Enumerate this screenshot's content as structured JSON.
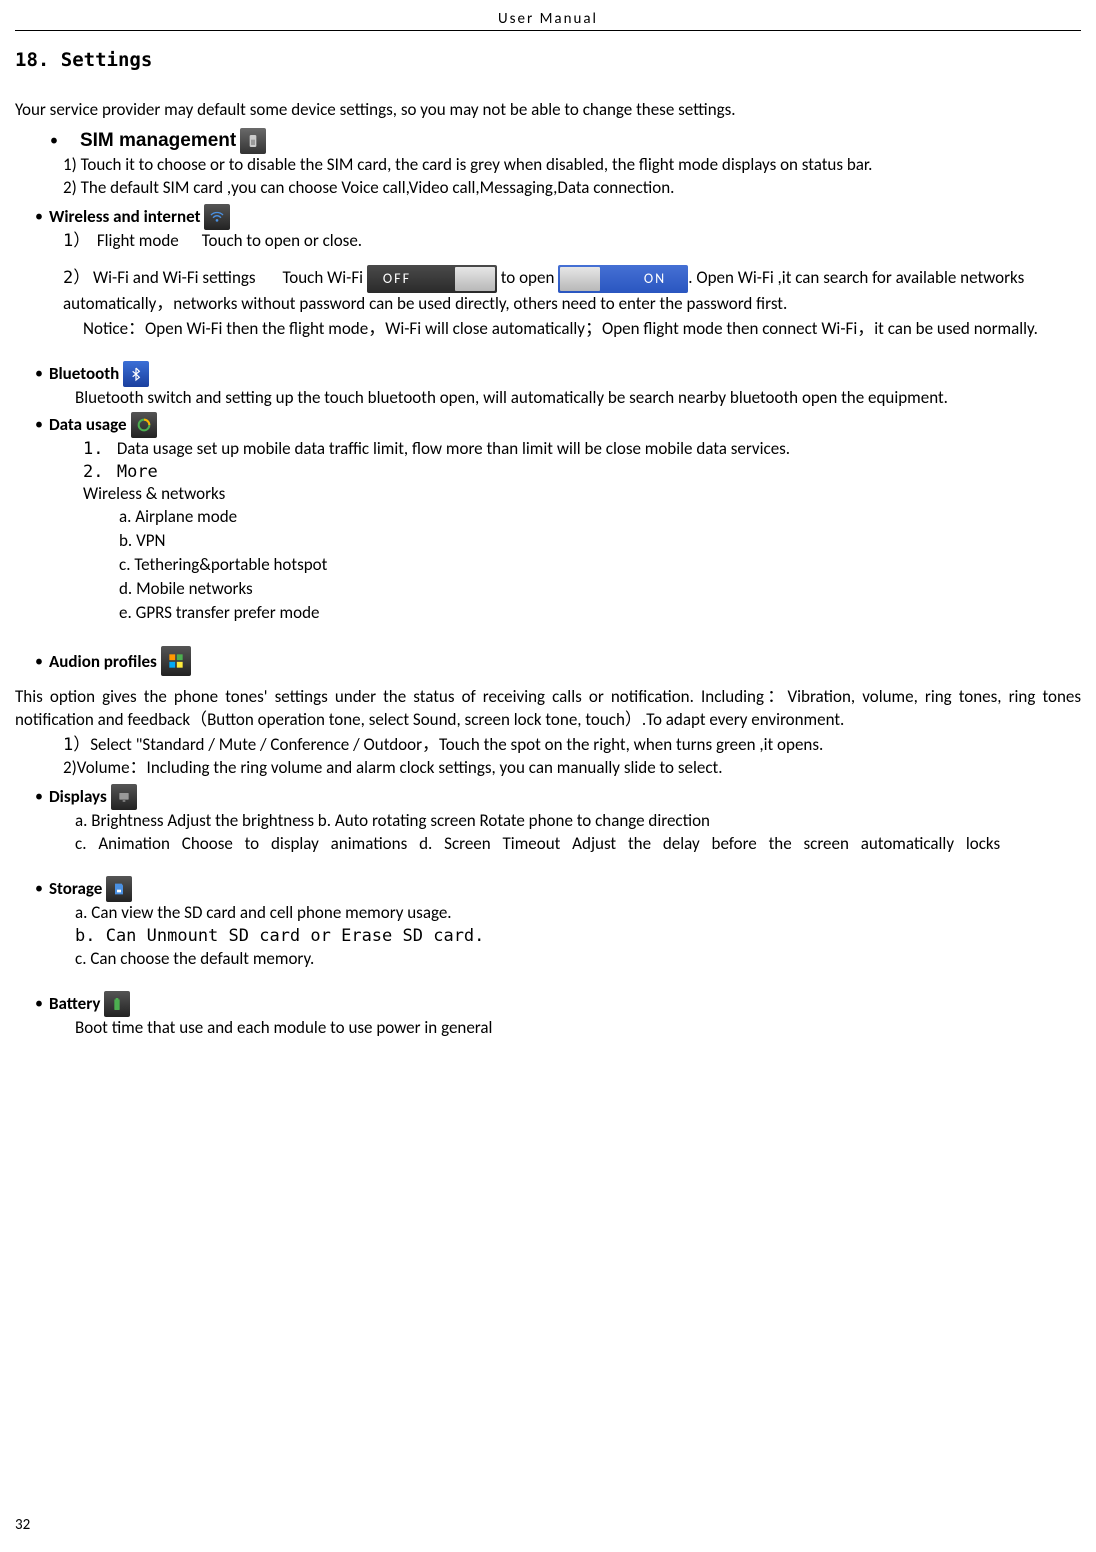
{
  "header": "User    Manual",
  "sectionTitle": "18. Settings",
  "intro": "Your service provider may default some device settings, so you may not be able to change these settings.",
  "sim": {
    "label": "SIM management",
    "p1": "1) Touch it to choose or to disable the SIM card, the card is grey when disabled, the flight mode displays on status bar.",
    "p2": "2) The default SIM card ,you can choose Voice call,Video call,Messaging,Data connection."
  },
  "wireless": {
    "label": "Wireless and internet",
    "n1": "1）",
    "flight_mode": "Flight mode",
    "flight_mode_desc": "Touch to open or close.",
    "n2": "2）",
    "wifi_a": "Wi-Fi and Wi-Fi settings",
    "wifi_b": "Touch Wi-Fi",
    "off": "OFF",
    "wifi_c": "to open",
    "on": "ON",
    "wifi_d": ". Open Wi-Fi ,it can search for available networks automatically，networks without password can be used directly, others need to enter the password first.",
    "notice": "Notice：Open Wi-Fi then the flight mode，Wi-Fi will close automatically；Open flight mode then connect Wi-Fi，it can be used normally."
  },
  "bt": {
    "label": "Bluetooth",
    "text": "Bluetooth switch and setting up the touch bluetooth open, will automatically be search nearby bluetooth open the equipment."
  },
  "data": {
    "label": "Data usage",
    "n1": "1.",
    "usage": "Data usage    set up mobile data traffic limit, flow more than limit will be close mobile data services.",
    "n2": "2.",
    "more": "More",
    "wireless_networks": "Wireless & networks",
    "a": "a.    Airplane mode",
    "b": "b.    VPN",
    "c": "c.    Tethering&portable hotspot",
    "d": "d.    Mobile networks",
    "e": "e.    GPRS transfer prefer mode"
  },
  "audio": {
    "label": "Audion profiles",
    "p1": "This option gives the phone tones' settings under the status of receiving calls or notification. Including：Vibration, volume, ring tones, ring tones notification and feedback（Button operation tone, select Sound, screen lock tone, touch）.To adapt every environment.",
    "s1num": "1）",
    "s1": "Select   \"Standard / Mute / Conference / Outdoor，Touch the spot on the right, when turns green ,it opens.",
    "s2": "2)Volume：Including the ring volume and alarm clock settings, you can manually slide to select."
  },
  "displays": {
    "label": "Displays",
    "line1": "a. Brightness Adjust the brightness      b. Auto rotating screen    Rotate phone to change direction",
    "line2": "c.  Animation    Choose  to  display  animations    d.  Screen  Timeout    Adjust  the  delay  before  the  screen automatically locks"
  },
  "storage": {
    "label": "Storage",
    "a": "a.    Can view the SD card and cell phone memory usage.",
    "b": "b.  Can Unmount SD card or Erase SD card.",
    "c": "c.    Can choose the default memory."
  },
  "battery": {
    "label": "Battery",
    "text": "Boot time that use and each module to use power in general"
  },
  "page": "32"
}
